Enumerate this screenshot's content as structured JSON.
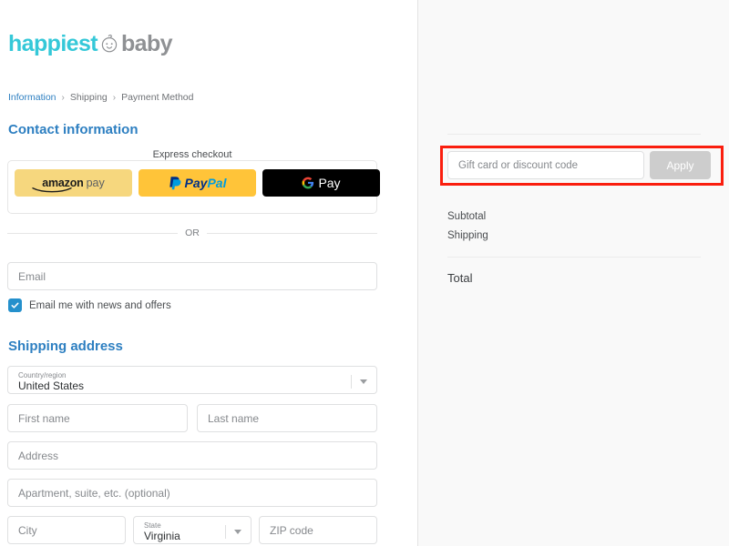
{
  "brand": {
    "name_part1": "happiest",
    "name_part2": "baby",
    "icon": "baby-face-icon",
    "color_primary": "#35c8d8",
    "color_secondary": "#8f9194"
  },
  "breadcrumb": {
    "items": [
      {
        "label": "Information",
        "active": true
      },
      {
        "label": "Shipping",
        "active": false
      },
      {
        "label": "Payment Method",
        "active": false
      }
    ],
    "separator": "›"
  },
  "contact": {
    "title": "Contact information",
    "express": {
      "label": "Express checkout",
      "buttons": [
        {
          "name": "amazon-pay",
          "text_primary": "amazon",
          "text_secondary": "pay",
          "bg": "#f6d77e"
        },
        {
          "name": "paypal",
          "text_primary": "Pay",
          "text_secondary": "Pal",
          "bg": "#ffc439"
        },
        {
          "name": "google-pay",
          "text_primary": "G",
          "text_secondary": "Pay",
          "bg": "#000000"
        }
      ]
    },
    "or_text": "OR",
    "email_placeholder": "Email",
    "newsletter_label": "Email me with news and offers",
    "newsletter_checked": true,
    "checkbox_color": "#2490cc"
  },
  "shipping": {
    "title": "Shipping address",
    "country": {
      "label": "Country/region",
      "value": "United States"
    },
    "first_name_placeholder": "First name",
    "last_name_placeholder": "Last name",
    "address_placeholder": "Address",
    "apartment_placeholder": "Apartment, suite, etc. (optional)",
    "city_placeholder": "City",
    "state": {
      "label": "State",
      "value": "Virginia"
    },
    "zip_placeholder": "ZIP code"
  },
  "summary": {
    "discount_placeholder": "Gift card or discount code",
    "apply_label": "Apply",
    "subtotal_label": "Subtotal",
    "subtotal_value": "",
    "shipping_label": "Shipping",
    "shipping_value": "",
    "total_label": "Total",
    "total_value": ""
  },
  "highlight": {
    "color": "#fa1e0e",
    "target": "discount-code-row"
  }
}
